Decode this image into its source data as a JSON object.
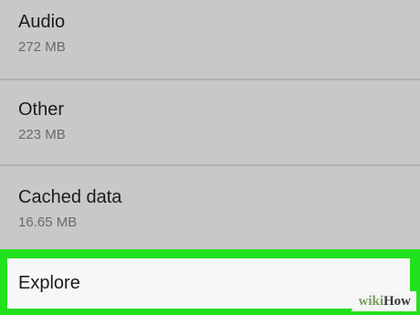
{
  "storage_list": {
    "items": [
      {
        "label": "Audio",
        "size": "272 MB"
      },
      {
        "label": "Other",
        "size": "223 MB"
      },
      {
        "label": "Cached data",
        "size": "16.65 MB"
      }
    ]
  },
  "explore": {
    "label": "Explore",
    "highlight_color": "#22e01c"
  },
  "watermark": {
    "wiki": "wiki",
    "how": "How"
  }
}
